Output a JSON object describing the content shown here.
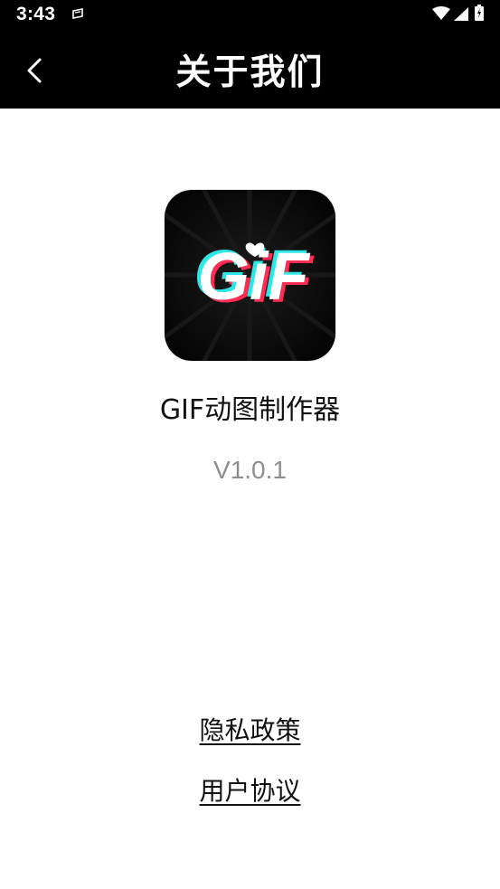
{
  "status_bar": {
    "time": "3:43",
    "icons": [
      "notification-icon",
      "wifi-icon",
      "signal-icon",
      "battery-icon"
    ]
  },
  "header": {
    "title": "关于我们",
    "back_icon": "chevron-left-icon"
  },
  "app": {
    "logo_text": "GiF",
    "name": "GIF动图制作器",
    "version": "V1.0.1"
  },
  "links": {
    "privacy": "隐私政策",
    "terms": "用户协议"
  },
  "colors": {
    "header_bg": "#000000",
    "logo_bg": "#0a0a0a",
    "logo_cyan": "#2ee6e6",
    "logo_red": "#ff2d55",
    "version_text": "#8e8e8e"
  }
}
